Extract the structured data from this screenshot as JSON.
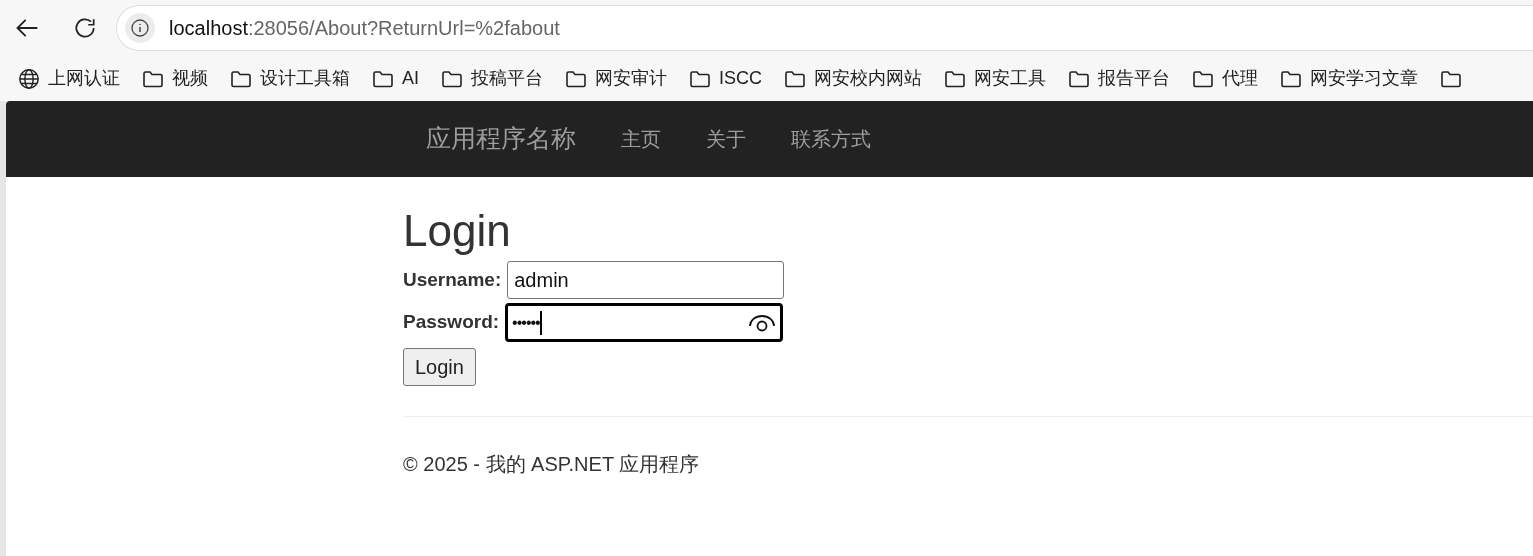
{
  "browser": {
    "address_host": "localhost",
    "address_path": ":28056/About?ReturnUrl=%2fabout",
    "bookmarks": [
      {
        "kind": "globe",
        "label": "上网认证"
      },
      {
        "kind": "folder",
        "label": "视频"
      },
      {
        "kind": "folder",
        "label": "设计工具箱"
      },
      {
        "kind": "folder",
        "label": "AI"
      },
      {
        "kind": "folder",
        "label": "投稿平台"
      },
      {
        "kind": "folder",
        "label": "网安审计"
      },
      {
        "kind": "folder",
        "label": "ISCC"
      },
      {
        "kind": "folder",
        "label": "网安校内网站"
      },
      {
        "kind": "folder",
        "label": "网安工具"
      },
      {
        "kind": "folder",
        "label": "报告平台"
      },
      {
        "kind": "folder",
        "label": "代理"
      },
      {
        "kind": "folder",
        "label": "网安学习文章"
      },
      {
        "kind": "folder"
      }
    ]
  },
  "navbar": {
    "brand": "应用程序名称",
    "links": [
      "主页",
      "关于",
      "联系方式"
    ]
  },
  "page": {
    "heading": "Login",
    "fields": [
      {
        "label": "Username:",
        "value": "admin",
        "focused": false,
        "kind": "text"
      },
      {
        "label": "Password:",
        "value": "••••••",
        "focused": true,
        "kind": "password"
      }
    ],
    "button": "Login",
    "footer": "© 2025 - 我的 ASP.NET 应用程序"
  }
}
